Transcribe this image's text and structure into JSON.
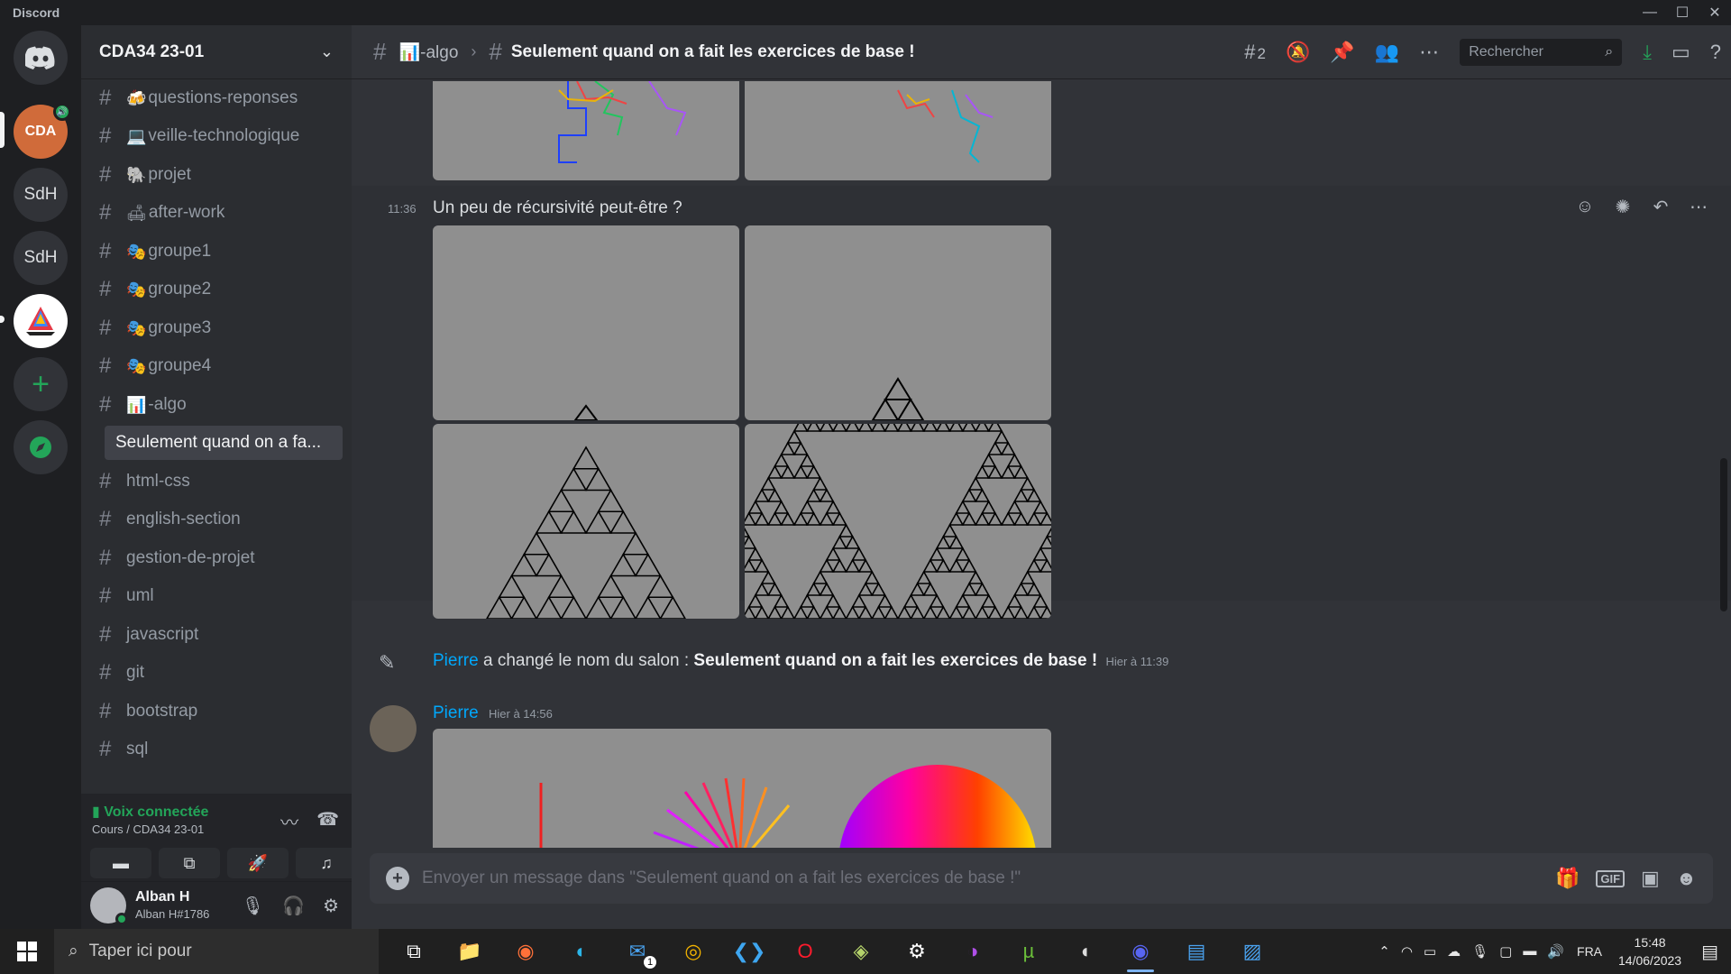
{
  "window": {
    "app_name": "Discord",
    "minimize": "—",
    "maximize": "☐",
    "close": "✕"
  },
  "servers": [
    {
      "label": "",
      "icon": "discord-icon"
    },
    {
      "label": "CDA",
      "icon": "server-avatar"
    },
    {
      "label": "SdH"
    },
    {
      "label": "SdH"
    },
    {
      "label": "",
      "icon": "sailboat-icon"
    },
    {
      "label": "+",
      "icon": "add-server-icon"
    },
    {
      "label": "",
      "icon": "compass-icon"
    }
  ],
  "sidebar": {
    "guild_name": "CDA34 23-01",
    "channels": [
      {
        "emoji": "🍻",
        "label": "questions-reponses",
        "type": "text"
      },
      {
        "emoji": "💻",
        "label": "veille-technologique",
        "type": "text"
      },
      {
        "emoji": "🐘",
        "label": "projet",
        "type": "text"
      },
      {
        "emoji": "🛋",
        "label": "after-work",
        "type": "text"
      },
      {
        "emoji": "🎭",
        "label": "groupe1",
        "type": "text"
      },
      {
        "emoji": "🎭",
        "label": "groupe2",
        "type": "text"
      },
      {
        "emoji": "🎭",
        "label": "groupe3",
        "type": "text"
      },
      {
        "emoji": "🎭",
        "label": "groupe4",
        "type": "text"
      },
      {
        "emoji": "📊",
        "label": "-algo",
        "type": "thread-parent"
      },
      {
        "emoji": "",
        "label": "Seulement quand on a fa...",
        "type": "thread"
      },
      {
        "emoji": "",
        "label": "html-css",
        "type": "thread-parent"
      },
      {
        "emoji": "",
        "label": "english-section",
        "type": "text"
      },
      {
        "emoji": "",
        "label": "gestion-de-projet",
        "type": "text"
      },
      {
        "emoji": "",
        "label": "uml",
        "type": "thread-parent"
      },
      {
        "emoji": "",
        "label": "javascript",
        "type": "text"
      },
      {
        "emoji": "",
        "label": "git",
        "type": "thread-parent"
      },
      {
        "emoji": "",
        "label": "bootstrap",
        "type": "text"
      },
      {
        "emoji": "",
        "label": "sql",
        "type": "text"
      }
    ],
    "voice": {
      "status": "Voix connectée",
      "channel": "Cours / CDA34 23-01"
    },
    "user": {
      "name": "Alban H",
      "tag": "Alban H#1786"
    }
  },
  "topbar": {
    "parent_channel": "-algo",
    "parent_emoji": "📊",
    "thread_title": "Seulement quand on a fait les exercices de base !",
    "thread_count": "2",
    "search_placeholder": "Rechercher"
  },
  "messages": {
    "msg1": {
      "time": "11:36",
      "text": "Un peu de récursivité peut-être ?"
    },
    "system": {
      "author": "Pierre",
      "action": "a changé le nom du salon :",
      "new_name": "Seulement quand on a fait les exercices de base !",
      "time": "Hier à 11:39"
    },
    "msg2": {
      "author": "Pierre",
      "time": "Hier à 14:56"
    }
  },
  "composer": {
    "placeholder": "Envoyer un message dans \"Seulement quand on a fait les exercices de base !\"",
    "gif": "GIF"
  },
  "taskbar": {
    "search_placeholder": "Taper ici pour",
    "lang": "FRA",
    "time": "15:48",
    "date": "14/06/2023",
    "mail_badge": "1"
  },
  "colors": {
    "accent": "#00a8fc",
    "online": "#23a559",
    "bg": "#313338"
  }
}
